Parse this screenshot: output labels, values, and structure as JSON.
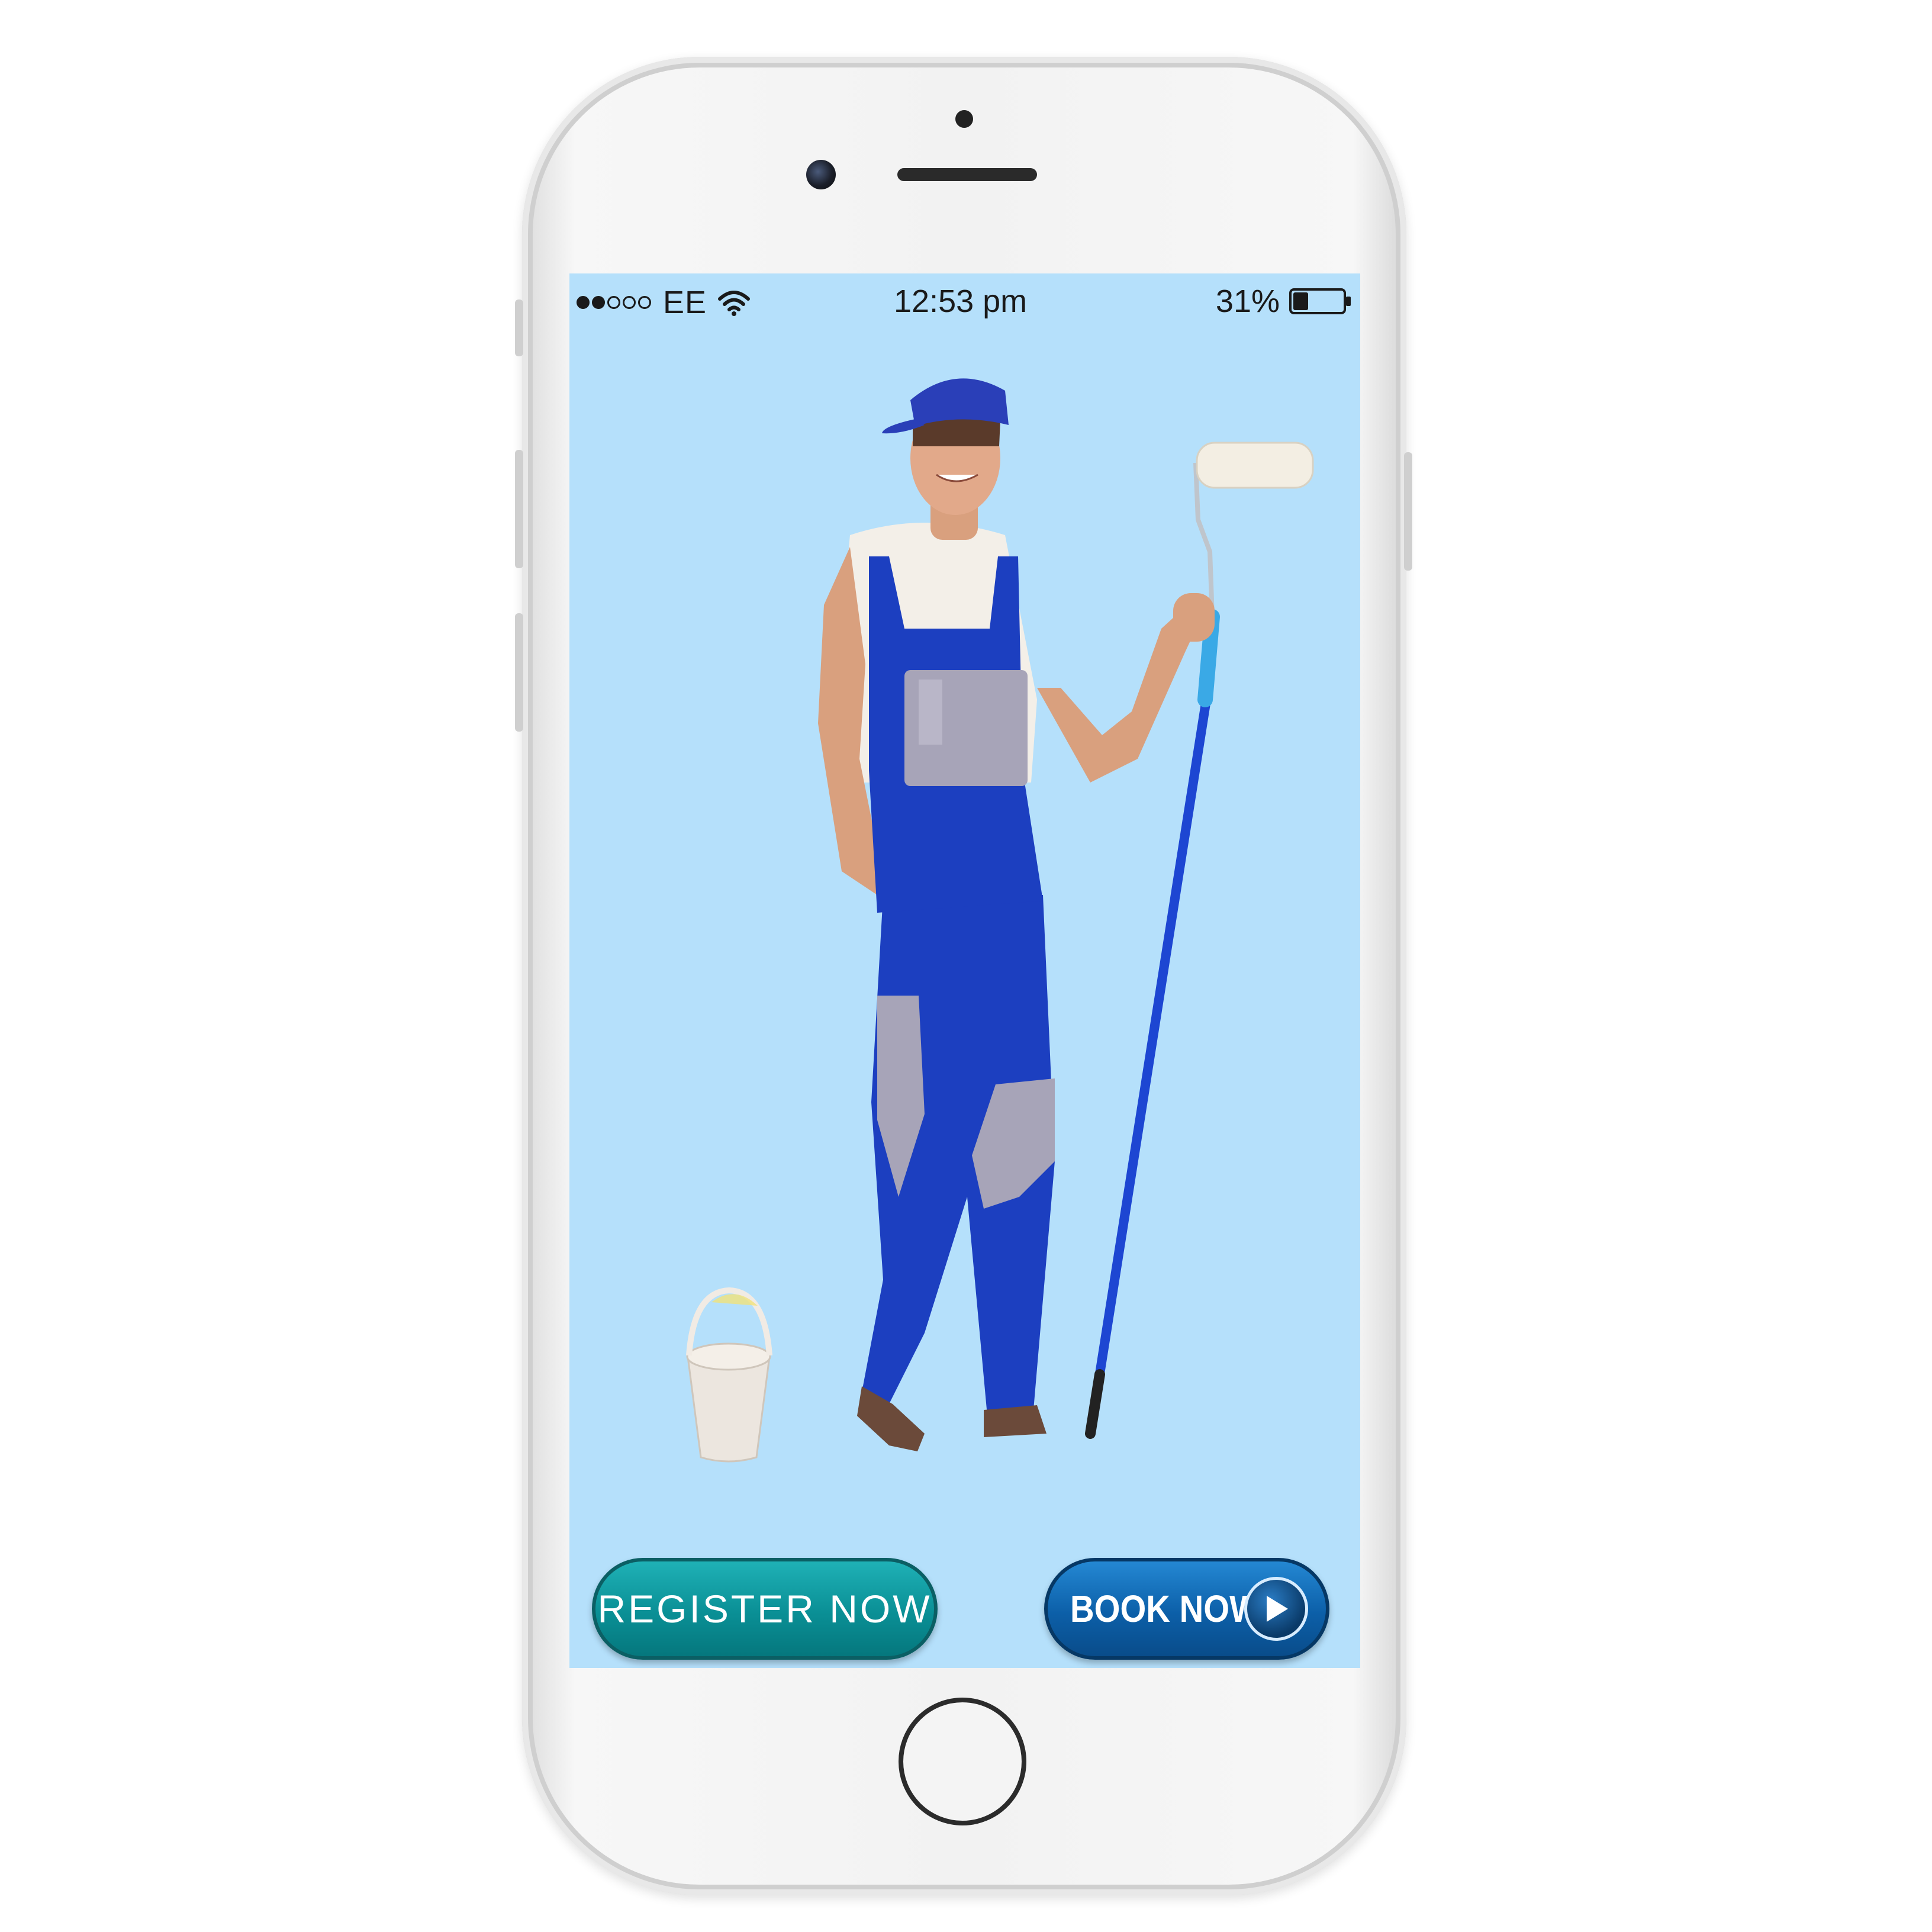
{
  "status_bar": {
    "signal_strength": "2 of 5",
    "carrier": "EE",
    "time": "12:53 pm",
    "battery_percent_label": "31%",
    "battery_level": 0.31,
    "icons": [
      "signal-dots-icon",
      "wifi-icon",
      "battery-icon"
    ]
  },
  "buttons": {
    "register_label": "REGISTER NOW",
    "book_label": "BOOK NOW",
    "book_icon": "play-icon"
  },
  "colors": {
    "screen_background": "#b5e0fb",
    "register_button": "#0a8f95",
    "book_button": "#0c5fa8",
    "overalls_blue": "#1c3fc0",
    "overalls_gray": "#a7a4b8"
  }
}
